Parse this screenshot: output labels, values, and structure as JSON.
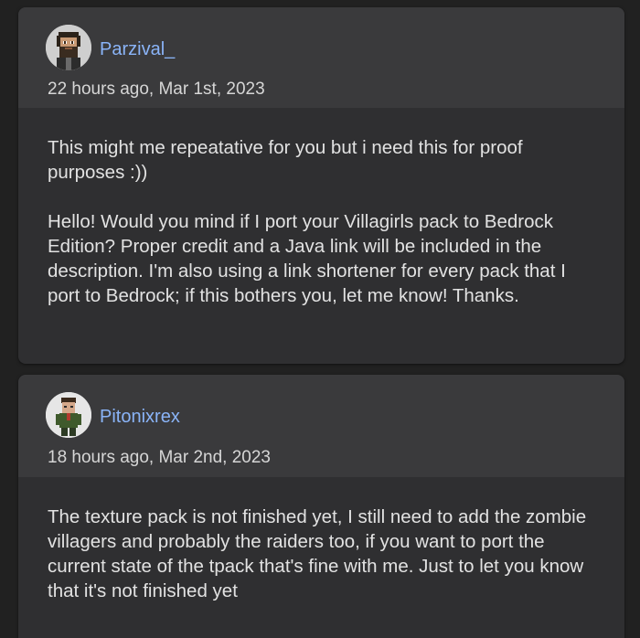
{
  "comments": [
    {
      "username": "Parzival_",
      "timestamp": "22 hours ago, Mar 1st, 2023",
      "avatar_icon": "bearded-man-pixel-avatar-icon",
      "paragraphs": [
        "This might me repeatative for you but i need this for proof purposes :))",
        "Hello! Would you mind if I port your Villagirls pack to Bedrock Edition? Proper credit and a Java link will be included in the description. I'm also using a link shortener for every pack that I port to Bedrock; if this bothers you, let me know! Thanks."
      ]
    },
    {
      "username": "Pitonixrex",
      "timestamp": "18 hours ago, Mar 2nd, 2023",
      "avatar_icon": "green-suit-character-avatar-icon",
      "paragraphs": [
        "The texture pack is not finished yet, I still need to add the zombie villagers and probably the raiders too, if you want to port the current state of the tpack that's fine with me. Just to let you know that it's not finished yet"
      ]
    }
  ],
  "colors": {
    "background": "#212121",
    "card": "#2f2f31",
    "card_header": "#3a3a3c",
    "username": "#8ab4f8",
    "text": "#e2e2e2"
  }
}
